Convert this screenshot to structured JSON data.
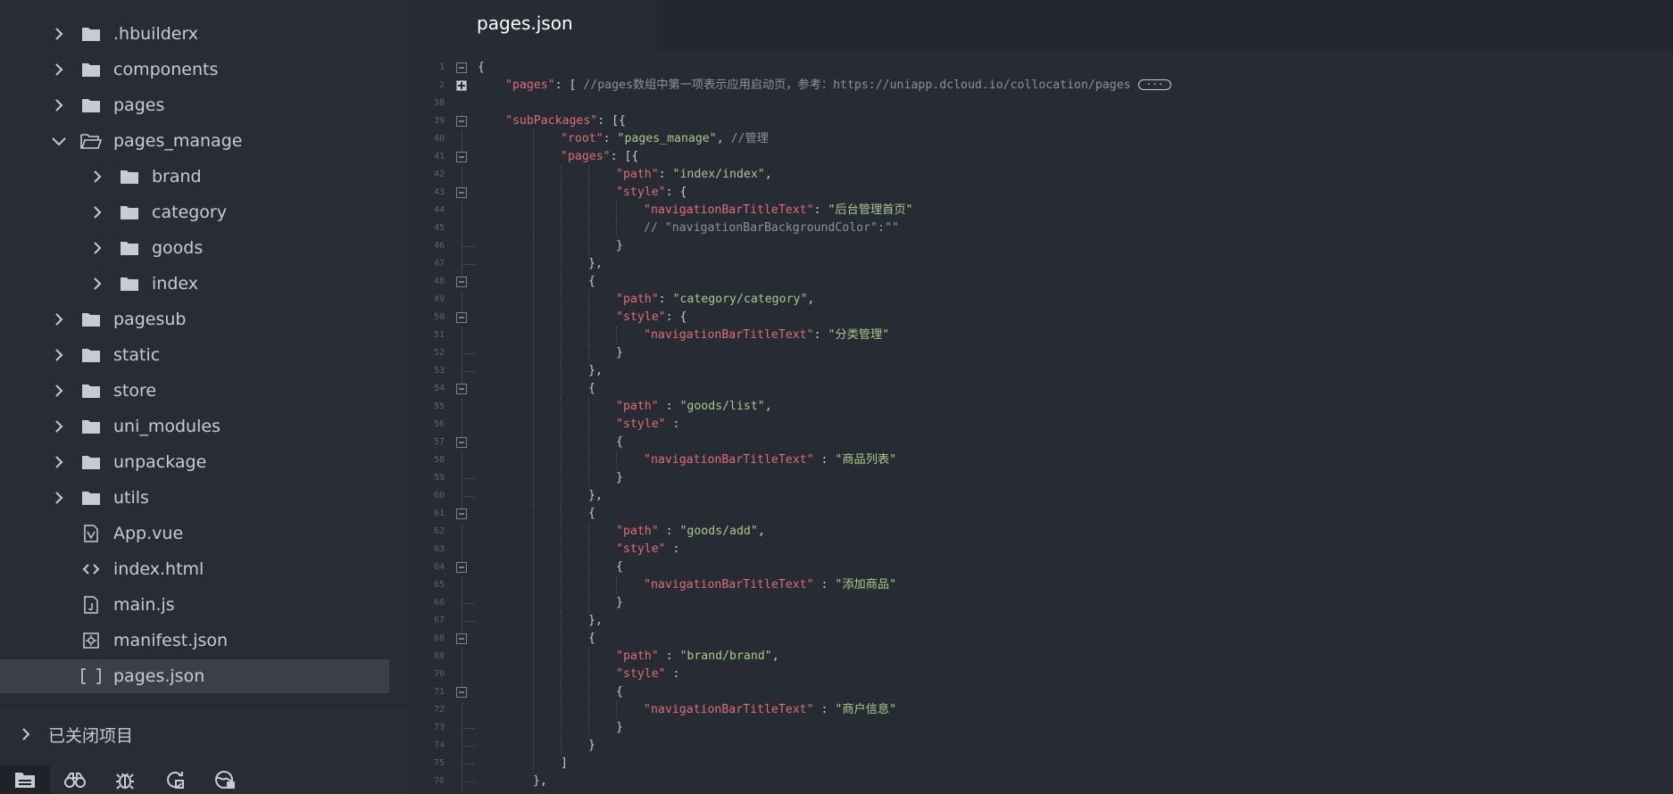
{
  "sidebar": {
    "tree": [
      {
        "label": ".hbuilderx",
        "type": "folder",
        "state": "collapsed",
        "depth": 0
      },
      {
        "label": "components",
        "type": "folder",
        "state": "collapsed",
        "depth": 0
      },
      {
        "label": "pages",
        "type": "folder",
        "state": "collapsed",
        "depth": 0
      },
      {
        "label": "pages_manage",
        "type": "folder",
        "state": "expanded",
        "depth": 0
      },
      {
        "label": "brand",
        "type": "folder",
        "state": "collapsed",
        "depth": 1
      },
      {
        "label": "category",
        "type": "folder",
        "state": "collapsed",
        "depth": 1
      },
      {
        "label": "goods",
        "type": "folder",
        "state": "collapsed",
        "depth": 1
      },
      {
        "label": "index",
        "type": "folder",
        "state": "collapsed",
        "depth": 1
      },
      {
        "label": "pagesub",
        "type": "folder",
        "state": "collapsed",
        "depth": 0
      },
      {
        "label": "static",
        "type": "folder",
        "state": "collapsed",
        "depth": 0
      },
      {
        "label": "store",
        "type": "folder",
        "state": "collapsed",
        "depth": 0
      },
      {
        "label": "uni_modules",
        "type": "folder",
        "state": "collapsed",
        "depth": 0
      },
      {
        "label": "unpackage",
        "type": "folder",
        "state": "collapsed",
        "depth": 0
      },
      {
        "label": "utils",
        "type": "folder",
        "state": "collapsed",
        "depth": 0
      },
      {
        "label": "App.vue",
        "type": "vue",
        "depth": 0
      },
      {
        "label": "index.html",
        "type": "html",
        "depth": 0
      },
      {
        "label": "main.js",
        "type": "js",
        "depth": 0
      },
      {
        "label": "manifest.json",
        "type": "manifest",
        "depth": 0
      },
      {
        "label": "pages.json",
        "type": "json",
        "depth": 0,
        "selected": true
      }
    ],
    "closed_projects": "已关闭项目",
    "toolbar": [
      "project-manager-icon",
      "binoculars-icon",
      "bug-icon",
      "refresh-plugin-icon",
      "browser-icon"
    ]
  },
  "editor": {
    "active_tab": "pages.json",
    "lines": [
      {
        "n": "1",
        "fold": "minus",
        "indent": 0,
        "tokens": [
          {
            "t": "p",
            "v": "{"
          }
        ]
      },
      {
        "n": "2",
        "fold": "plus",
        "indent": 1,
        "tokens": [
          {
            "t": "k",
            "v": "\"pages\""
          },
          {
            "t": "p",
            "v": ": [ "
          },
          {
            "t": "c",
            "v": "//pages数组中第一项表示应用启动页，参考：https://uniapp.dcloud.io/collocation/pages"
          }
        ],
        "ellipsis": "···"
      },
      {
        "n": "38",
        "fold": "",
        "indent": 0,
        "tokens": []
      },
      {
        "n": "39",
        "fold": "minus",
        "indent": 1,
        "tokens": [
          {
            "t": "k",
            "v": "\"subPackages\""
          },
          {
            "t": "p",
            "v": ": [{"
          }
        ]
      },
      {
        "n": "40",
        "fold": "",
        "indent": 3,
        "tokens": [
          {
            "t": "k",
            "v": "\"root\""
          },
          {
            "t": "p",
            "v": ": "
          },
          {
            "t": "s",
            "v": "\"pages_manage\""
          },
          {
            "t": "p",
            "v": ", "
          },
          {
            "t": "c",
            "v": "//管理"
          }
        ]
      },
      {
        "n": "41",
        "fold": "minus",
        "indent": 3,
        "tokens": [
          {
            "t": "k",
            "v": "\"pages\""
          },
          {
            "t": "p",
            "v": ": [{"
          }
        ]
      },
      {
        "n": "42",
        "fold": "",
        "indent": 5,
        "tokens": [
          {
            "t": "k",
            "v": "\"path\""
          },
          {
            "t": "p",
            "v": ": "
          },
          {
            "t": "s",
            "v": "\"index/index\""
          },
          {
            "t": "p",
            "v": ","
          }
        ]
      },
      {
        "n": "43",
        "fold": "minus",
        "indent": 5,
        "tokens": [
          {
            "t": "k",
            "v": "\"style\""
          },
          {
            "t": "p",
            "v": ": {"
          }
        ]
      },
      {
        "n": "44",
        "fold": "",
        "indent": 6,
        "tokens": [
          {
            "t": "k",
            "v": "\"navigationBarTitleText\""
          },
          {
            "t": "p",
            "v": ": "
          },
          {
            "t": "s",
            "v": "\"后台管理首页\""
          }
        ]
      },
      {
        "n": "45",
        "fold": "",
        "indent": 6,
        "tokens": [
          {
            "t": "c",
            "v": "// \"navigationBarBackgroundColor\":\"\""
          }
        ]
      },
      {
        "n": "46",
        "fold": "end",
        "indent": 5,
        "tokens": [
          {
            "t": "p",
            "v": "}"
          }
        ]
      },
      {
        "n": "47",
        "fold": "end",
        "indent": 4,
        "tokens": [
          {
            "t": "p",
            "v": "},"
          }
        ]
      },
      {
        "n": "48",
        "fold": "minus",
        "indent": 4,
        "tokens": [
          {
            "t": "p",
            "v": "{"
          }
        ]
      },
      {
        "n": "49",
        "fold": "",
        "indent": 5,
        "tokens": [
          {
            "t": "k",
            "v": "\"path\""
          },
          {
            "t": "p",
            "v": ": "
          },
          {
            "t": "s",
            "v": "\"category/category\""
          },
          {
            "t": "p",
            "v": ","
          }
        ]
      },
      {
        "n": "50",
        "fold": "minus",
        "indent": 5,
        "tokens": [
          {
            "t": "k",
            "v": "\"style\""
          },
          {
            "t": "p",
            "v": ": {"
          }
        ]
      },
      {
        "n": "51",
        "fold": "",
        "indent": 6,
        "tokens": [
          {
            "t": "k",
            "v": "\"navigationBarTitleText\""
          },
          {
            "t": "p",
            "v": ": "
          },
          {
            "t": "s",
            "v": "\"分类管理\""
          }
        ]
      },
      {
        "n": "52",
        "fold": "end",
        "indent": 5,
        "tokens": [
          {
            "t": "p",
            "v": "}"
          }
        ]
      },
      {
        "n": "53",
        "fold": "end",
        "indent": 4,
        "tokens": [
          {
            "t": "p",
            "v": "},"
          }
        ]
      },
      {
        "n": "54",
        "fold": "minus",
        "indent": 4,
        "tokens": [
          {
            "t": "p",
            "v": "{"
          }
        ]
      },
      {
        "n": "55",
        "fold": "",
        "indent": 5,
        "tokens": [
          {
            "t": "k",
            "v": "\"path\""
          },
          {
            "t": "p",
            "v": " : "
          },
          {
            "t": "s",
            "v": "\"goods/list\""
          },
          {
            "t": "p",
            "v": ","
          }
        ]
      },
      {
        "n": "56",
        "fold": "",
        "indent": 5,
        "tokens": [
          {
            "t": "k",
            "v": "\"style\""
          },
          {
            "t": "p",
            "v": " :"
          }
        ]
      },
      {
        "n": "57",
        "fold": "minus",
        "indent": 5,
        "tokens": [
          {
            "t": "p",
            "v": "{"
          }
        ]
      },
      {
        "n": "58",
        "fold": "",
        "indent": 6,
        "tokens": [
          {
            "t": "k",
            "v": "\"navigationBarTitleText\""
          },
          {
            "t": "p",
            "v": " : "
          },
          {
            "t": "s",
            "v": "\"商品列表\""
          }
        ]
      },
      {
        "n": "59",
        "fold": "end",
        "indent": 5,
        "tokens": [
          {
            "t": "p",
            "v": "}"
          }
        ]
      },
      {
        "n": "60",
        "fold": "end",
        "indent": 4,
        "tokens": [
          {
            "t": "p",
            "v": "},"
          }
        ]
      },
      {
        "n": "61",
        "fold": "minus",
        "indent": 4,
        "tokens": [
          {
            "t": "p",
            "v": "{"
          }
        ]
      },
      {
        "n": "62",
        "fold": "",
        "indent": 5,
        "tokens": [
          {
            "t": "k",
            "v": "\"path\""
          },
          {
            "t": "p",
            "v": " : "
          },
          {
            "t": "s",
            "v": "\"goods/add\""
          },
          {
            "t": "p",
            "v": ","
          }
        ]
      },
      {
        "n": "63",
        "fold": "",
        "indent": 5,
        "tokens": [
          {
            "t": "k",
            "v": "\"style\""
          },
          {
            "t": "p",
            "v": " :"
          }
        ]
      },
      {
        "n": "64",
        "fold": "minus",
        "indent": 5,
        "tokens": [
          {
            "t": "p",
            "v": "{"
          }
        ]
      },
      {
        "n": "65",
        "fold": "",
        "indent": 6,
        "tokens": [
          {
            "t": "k",
            "v": "\"navigationBarTitleText\""
          },
          {
            "t": "p",
            "v": " : "
          },
          {
            "t": "s",
            "v": "\"添加商品\""
          }
        ]
      },
      {
        "n": "66",
        "fold": "end",
        "indent": 5,
        "tokens": [
          {
            "t": "p",
            "v": "}"
          }
        ]
      },
      {
        "n": "67",
        "fold": "end",
        "indent": 4,
        "tokens": [
          {
            "t": "p",
            "v": "},"
          }
        ]
      },
      {
        "n": "68",
        "fold": "minus",
        "indent": 4,
        "tokens": [
          {
            "t": "p",
            "v": "{"
          }
        ]
      },
      {
        "n": "69",
        "fold": "",
        "indent": 5,
        "tokens": [
          {
            "t": "k",
            "v": "\"path\""
          },
          {
            "t": "p",
            "v": " : "
          },
          {
            "t": "s",
            "v": "\"brand/brand\""
          },
          {
            "t": "p",
            "v": ","
          }
        ]
      },
      {
        "n": "70",
        "fold": "",
        "indent": 5,
        "tokens": [
          {
            "t": "k",
            "v": "\"style\""
          },
          {
            "t": "p",
            "v": " :"
          }
        ]
      },
      {
        "n": "71",
        "fold": "minus",
        "indent": 5,
        "tokens": [
          {
            "t": "p",
            "v": "{"
          }
        ]
      },
      {
        "n": "72",
        "fold": "",
        "indent": 6,
        "tokens": [
          {
            "t": "k",
            "v": "\"navigationBarTitleText\""
          },
          {
            "t": "p",
            "v": " : "
          },
          {
            "t": "s",
            "v": "\"商户信息\""
          }
        ]
      },
      {
        "n": "73",
        "fold": "end",
        "indent": 5,
        "tokens": [
          {
            "t": "p",
            "v": "}"
          }
        ]
      },
      {
        "n": "74",
        "fold": "end",
        "indent": 4,
        "tokens": [
          {
            "t": "p",
            "v": "}"
          }
        ]
      },
      {
        "n": "75",
        "fold": "end",
        "indent": 3,
        "tokens": [
          {
            "t": "p",
            "v": "]"
          }
        ]
      },
      {
        "n": "76",
        "fold": "end",
        "indent": 2,
        "tokens": [
          {
            "t": "p",
            "v": "},"
          }
        ]
      }
    ]
  },
  "colors": {
    "background": "#272b33",
    "sidebar": "#282c34",
    "key": "#e06c75",
    "string": "#a8c98a",
    "comment": "#8c929c",
    "text": "#c5cad3",
    "selected_row": "#3b3f48"
  }
}
